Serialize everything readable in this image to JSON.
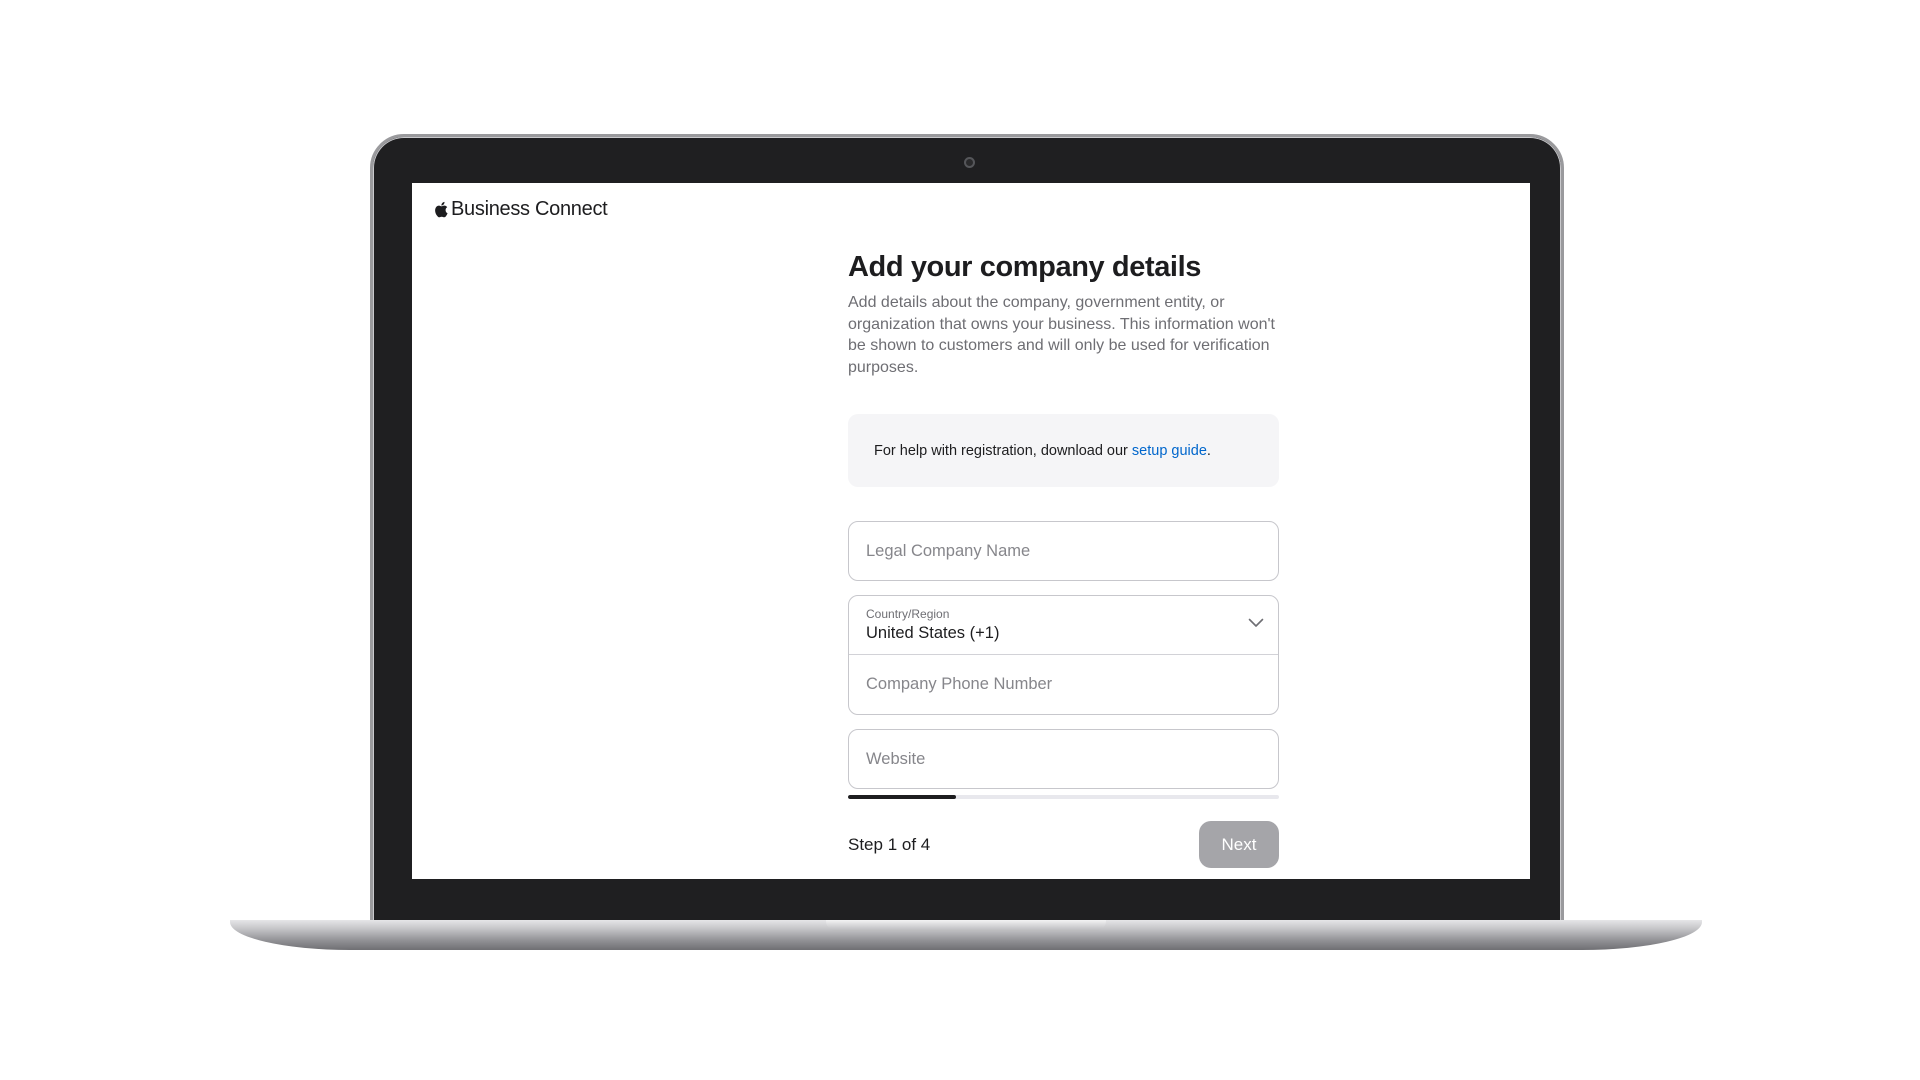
{
  "brand": {
    "name": "Business Connect",
    "logo_icon": "apple-logo-icon"
  },
  "page": {
    "title": "Add your company details",
    "description": "Add details about the company, government entity, or organization that owns your business. This information won't be shown to customers and will only be used for verification purposes."
  },
  "help": {
    "text": "For help with registration, download our ",
    "link_label": "setup guide",
    "trailing": "."
  },
  "form": {
    "legal_name": {
      "placeholder": "Legal Company Name",
      "value": ""
    },
    "country": {
      "label": "Country/Region",
      "value": "United States (+1)",
      "icon": "chevron-down-icon"
    },
    "phone": {
      "placeholder": "Company Phone Number",
      "value": ""
    },
    "website": {
      "placeholder": "Website",
      "value": ""
    }
  },
  "progress": {
    "current_step": 1,
    "total_steps": 4,
    "fraction": 0.25
  },
  "footer": {
    "step_label": "Step 1 of 4",
    "next_label": "Next"
  },
  "colors": {
    "link": "#0066cc",
    "next_disabled": "#a5a5a9",
    "progress_fill": "#1d1d1f",
    "help_bg": "#f5f5f7"
  }
}
